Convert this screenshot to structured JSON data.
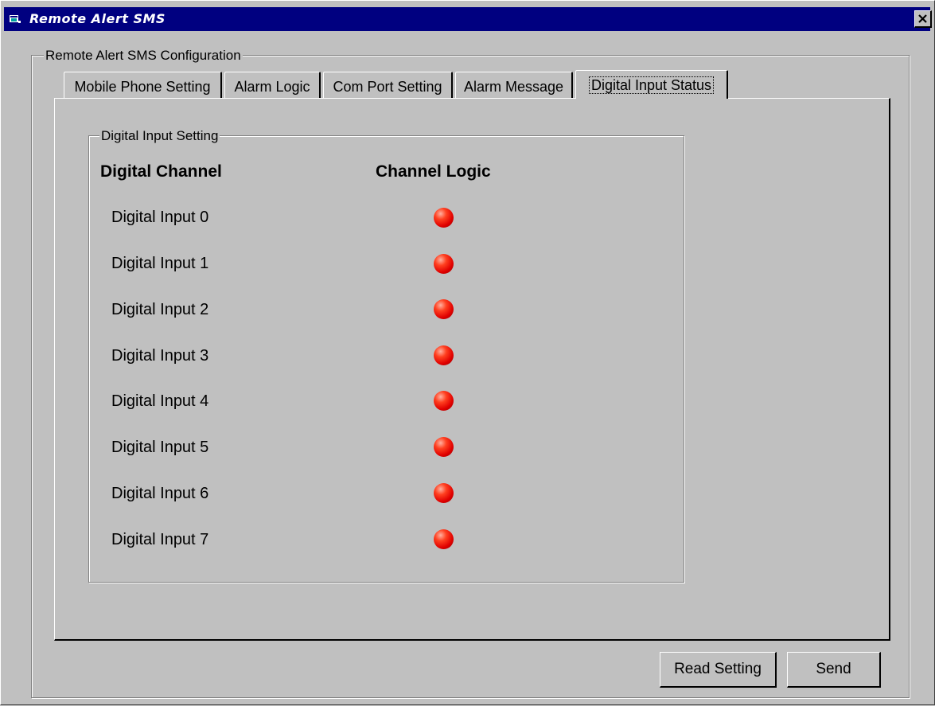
{
  "window": {
    "title": "Remote Alert SMS",
    "close_label": "✕"
  },
  "config_group": {
    "caption": "Remote Alert SMS Configuration"
  },
  "tabs": [
    {
      "label": "Mobile Phone Setting",
      "active": false
    },
    {
      "label": "Alarm Logic",
      "active": false
    },
    {
      "label": "Com Port Setting",
      "active": false
    },
    {
      "label": "Alarm Message",
      "active": false
    },
    {
      "label": "Digital Input Status",
      "active": true
    }
  ],
  "digital_group": {
    "caption": "Digital Input Setting",
    "header_channel": "Digital Channel",
    "header_logic": "Channel Logic",
    "rows": [
      {
        "label": "Digital Input 0",
        "led_color": "#e00000"
      },
      {
        "label": "Digital Input 1",
        "led_color": "#e00000"
      },
      {
        "label": "Digital Input 2",
        "led_color": "#e00000"
      },
      {
        "label": "Digital Input 3",
        "led_color": "#e00000"
      },
      {
        "label": "Digital Input 4",
        "led_color": "#e00000"
      },
      {
        "label": "Digital Input 5",
        "led_color": "#e00000"
      },
      {
        "label": "Digital Input 6",
        "led_color": "#e00000"
      },
      {
        "label": "Digital Input 7",
        "led_color": "#e00000"
      }
    ]
  },
  "buttons": {
    "read_setting": "Read Setting",
    "send": "Send"
  },
  "colors": {
    "title_bar": "#000080",
    "face": "#c0c0c0",
    "led_on": "#e00000"
  }
}
